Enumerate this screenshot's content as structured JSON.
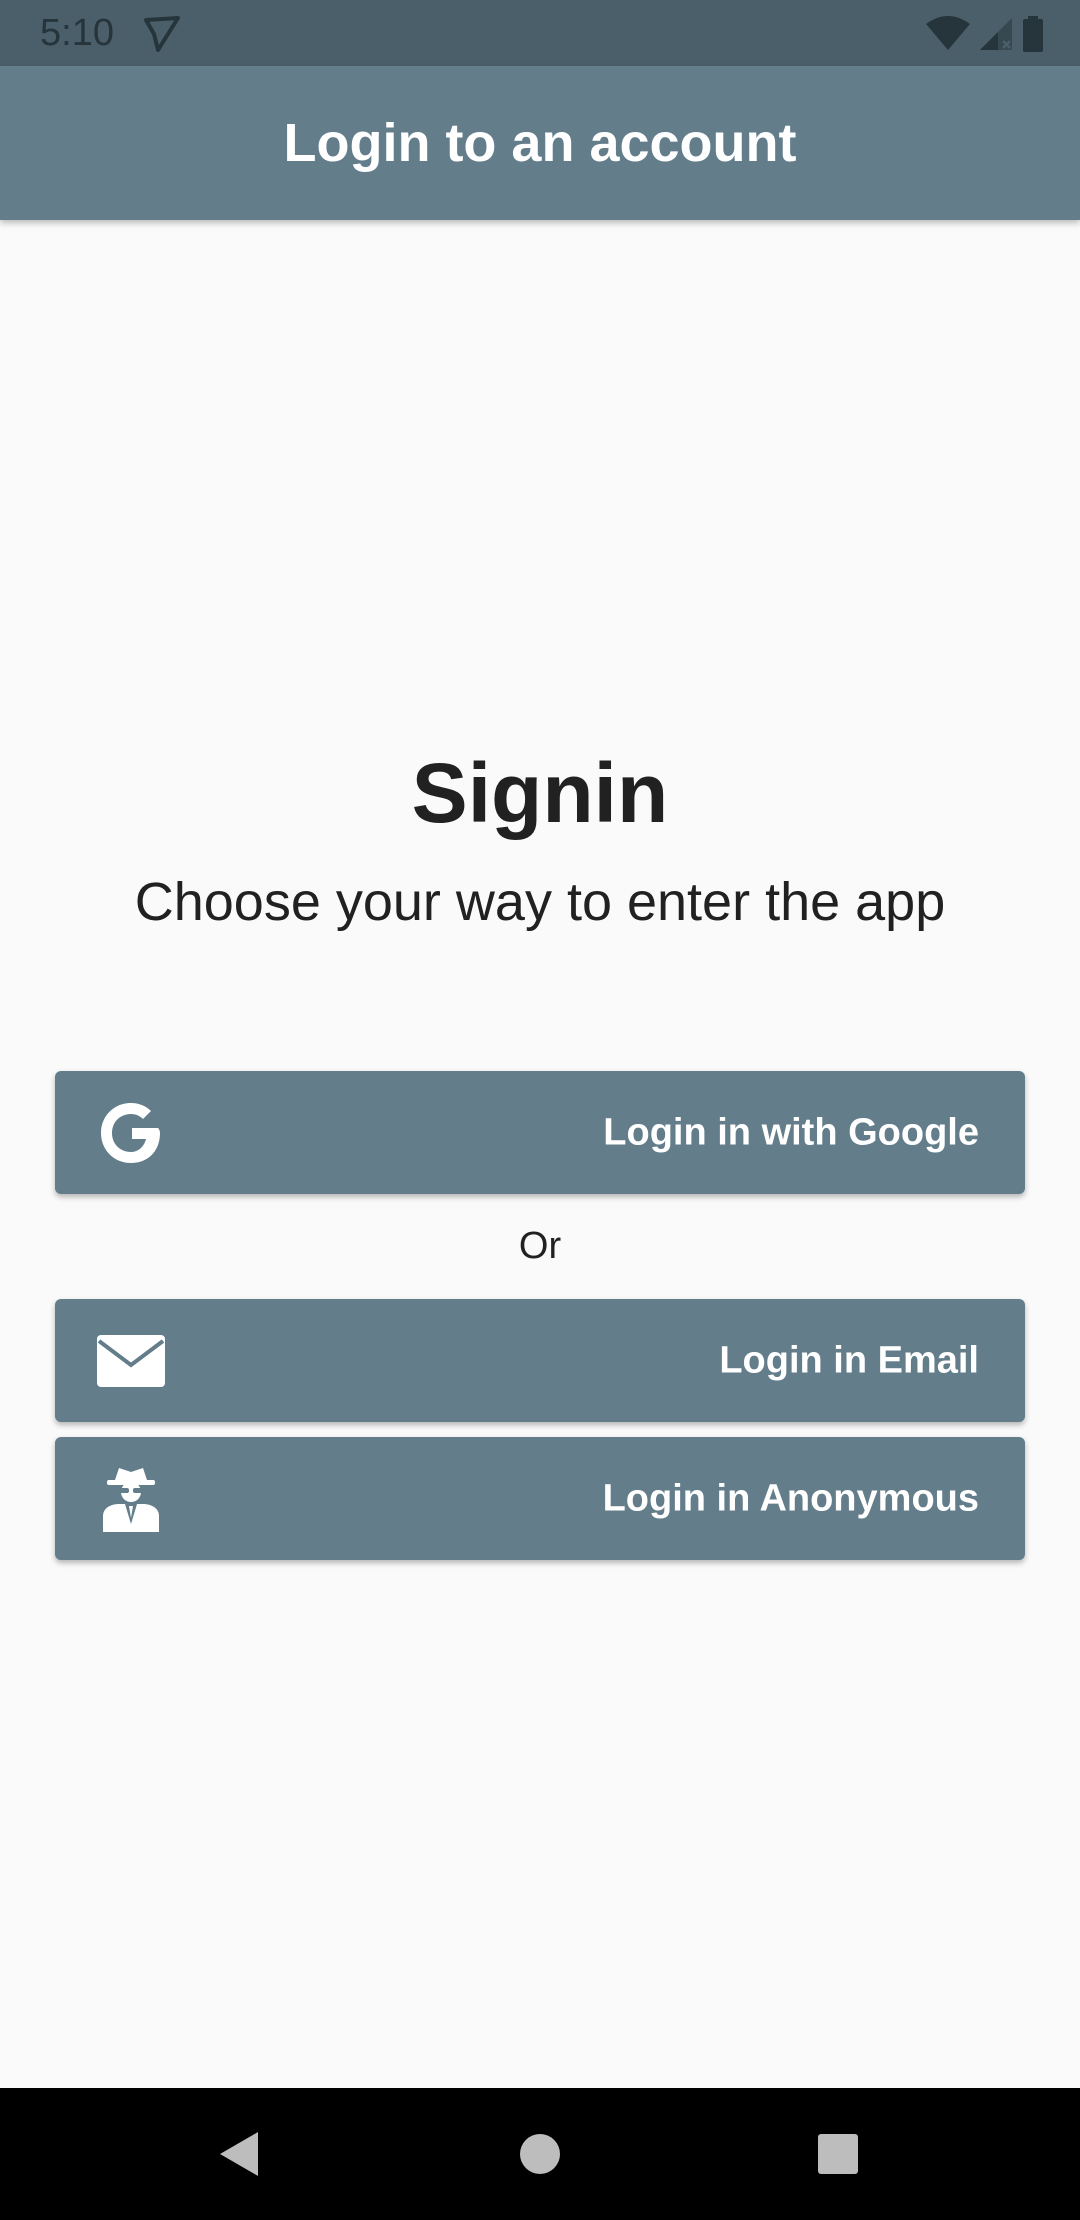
{
  "status_bar": {
    "time": "5:10"
  },
  "app_bar": {
    "title": "Login to an account"
  },
  "main": {
    "heading": "Signin",
    "subheading": "Choose your way to enter the app",
    "or_label": "Or",
    "buttons": [
      {
        "label": "Login in with Google",
        "icon": "google-icon"
      },
      {
        "label": "Login in Email",
        "icon": "envelope-icon"
      },
      {
        "label": "Login in Anonymous",
        "icon": "incognito-icon"
      }
    ]
  },
  "colors": {
    "primary": "#637d8b",
    "status_bar": "#4b5f6b",
    "background": "#fafafa",
    "text": "#212121"
  }
}
